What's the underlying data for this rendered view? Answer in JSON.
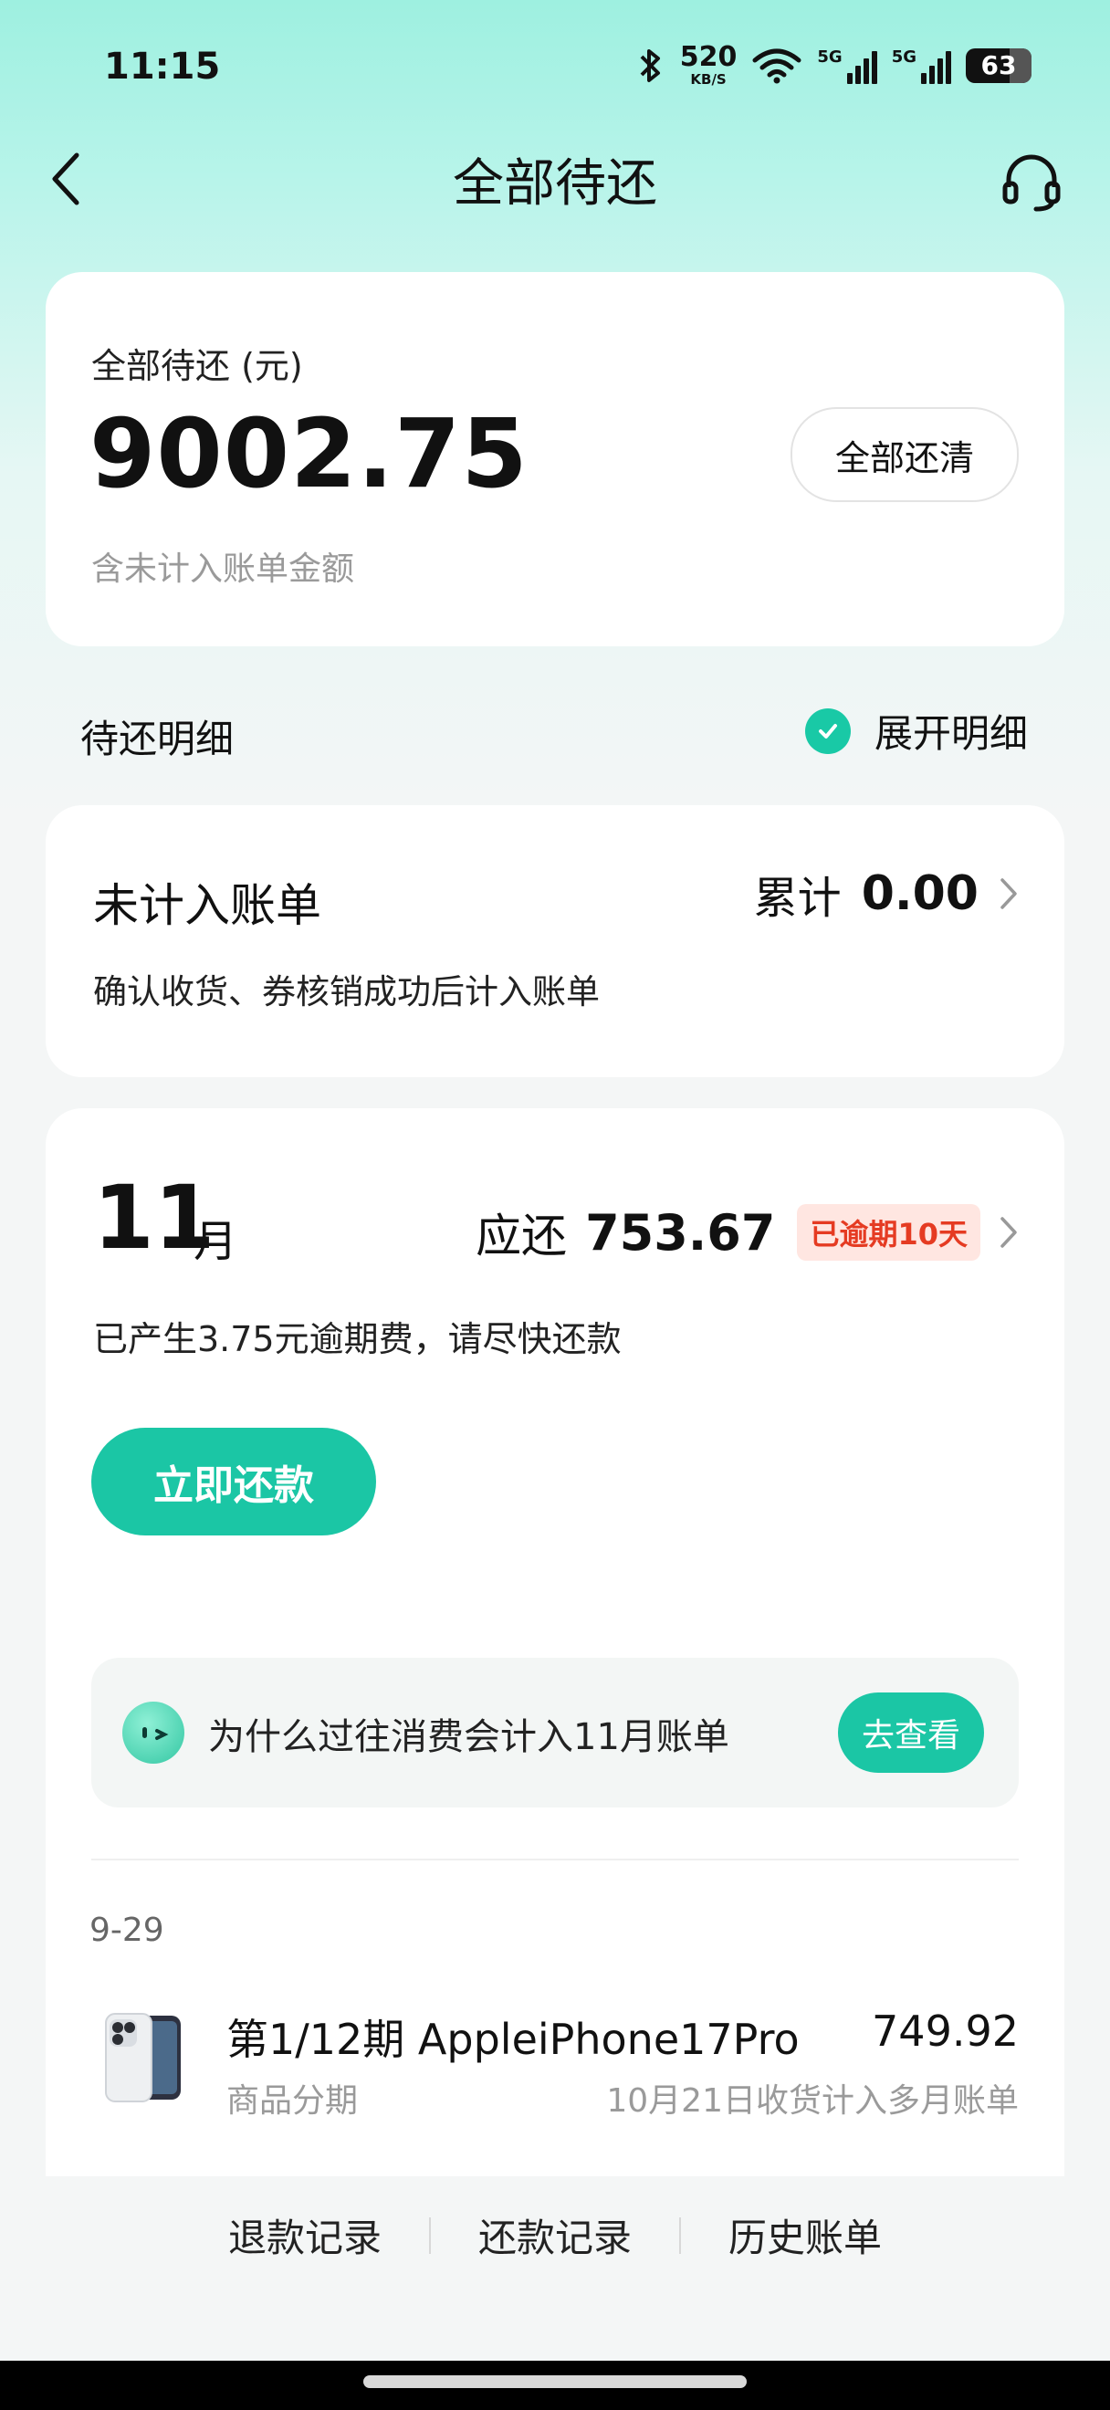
{
  "status_bar": {
    "time": "11:15",
    "net_speed_value": "520",
    "net_speed_unit": "KB/S",
    "signal_1_label": "5G",
    "signal_2_label": "5G",
    "battery": "63"
  },
  "header": {
    "title": "全部待还"
  },
  "summary": {
    "label": "全部待还 (元)",
    "amount": "9002.75",
    "note": "含未计入账单金额",
    "payoff_button": "全部还清"
  },
  "section": {
    "title": "待还明细",
    "expand_label": "展开明细"
  },
  "unbilled": {
    "title": "未计入账单",
    "total_label": "累计",
    "total_value": "0.00",
    "description": "确认收货、券核销成功后计入账单"
  },
  "month_bill": {
    "month_number": "11",
    "month_unit": "月",
    "due_label": "应还",
    "due_amount": "753.67",
    "overdue_badge": "已逾期10天",
    "overdue_notice": "已产生3.75元逾期费，请尽快还款",
    "pay_button": "立即还款",
    "tip_text": "为什么过往消费会计入11月账单",
    "tip_button": "去查看",
    "orders": [
      {
        "date": "9-29",
        "title": "第1/12期 AppleiPhone17Pro",
        "amount": "749.92",
        "type": "商品分期",
        "note": "10月21日收货计入多月账单"
      }
    ]
  },
  "bottom_links": {
    "refunds": "退款记录",
    "repayments": "还款记录",
    "history": "历史账单"
  },
  "colors": {
    "accent": "#1bc6a5",
    "overdue_text": "#e53b22",
    "overdue_bg": "#ffe6e1"
  }
}
